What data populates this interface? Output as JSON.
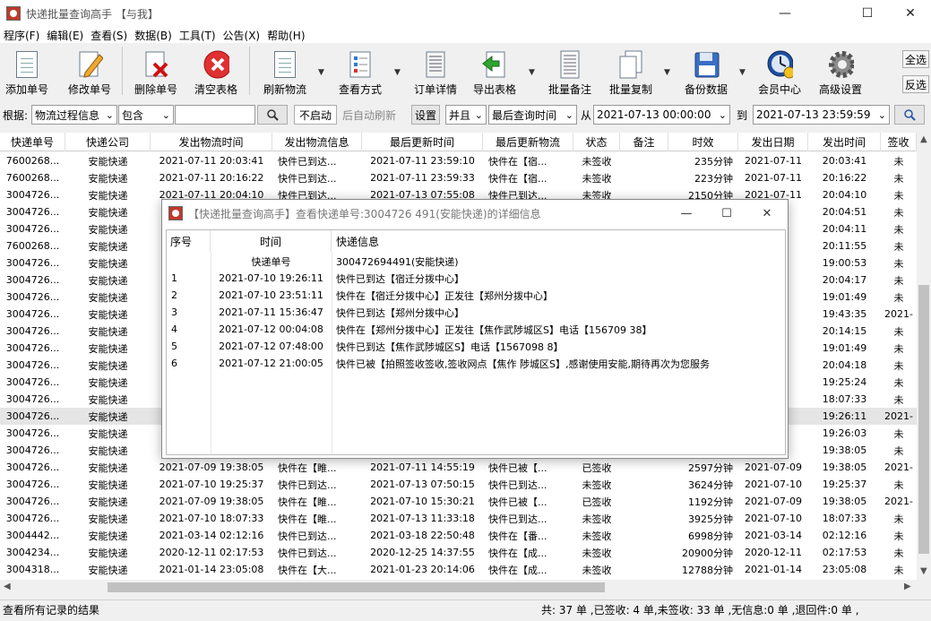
{
  "window": {
    "title": "快递批量查询高手 【与我】",
    "minimize": "—",
    "maximize": "☐",
    "close": "✕"
  },
  "menu": [
    "程序(F)",
    "编辑(E)",
    "查看(S)",
    "数据(B)",
    "工具(T)",
    "公告(X)",
    "帮助(H)"
  ],
  "toolbar": {
    "buttons": [
      {
        "label": "添加单号",
        "icon": "new-document-icon"
      },
      {
        "label": "修改单号",
        "icon": "edit-pencil-icon"
      },
      {
        "label": "删除单号",
        "icon": "delete-document-icon"
      },
      {
        "label": "清空表格",
        "icon": "clear-table-icon"
      },
      {
        "label": "刷新物流",
        "icon": "refresh-document-icon"
      },
      {
        "label": "查看方式",
        "icon": "view-mode-icon"
      },
      {
        "label": "订单详情",
        "icon": "order-detail-icon"
      },
      {
        "label": "导出表格",
        "icon": "export-table-icon"
      },
      {
        "label": "批量备注",
        "icon": "batch-note-icon"
      },
      {
        "label": "批量复制",
        "icon": "batch-copy-icon"
      },
      {
        "label": "备份数据",
        "icon": "backup-floppy-icon"
      },
      {
        "label": "会员中心",
        "icon": "member-center-icon"
      },
      {
        "label": "高级设置",
        "icon": "gear-icon"
      }
    ],
    "select_all": "全选",
    "invert": "反选"
  },
  "filter": {
    "by_label": "根据:",
    "field": "物流过程信息",
    "match": "包含",
    "keyword": "",
    "auto_refresh_state": "不启动",
    "auto_refresh_label": "后自动刷新",
    "settings": "设置",
    "logic": "并且",
    "date_field": "最后查询时间",
    "from_label": "从",
    "from_value": "2021-07-13 00:00:00",
    "to_label": "到",
    "to_value": "2021-07-13 23:59:59"
  },
  "table": {
    "columns": [
      "快递单号",
      "快递公司",
      "发出物流时间",
      "发出物流信息",
      "最后更新时间",
      "最后更新物流",
      "状态",
      "备注",
      "时效",
      "发出日期",
      "发出时间",
      "签收"
    ],
    "rows": [
      [
        "7600268...",
        "安能快递",
        "2021-07-11 20:03:41",
        "快件已到达...",
        "2021-07-11 23:59:10",
        "快件在【宿...",
        "未签收",
        "",
        "235分钟",
        "2021-07-11",
        "20:03:41",
        "未"
      ],
      [
        "7600268...",
        "安能快递",
        "2021-07-11 20:16:22",
        "快件已到达...",
        "2021-07-11 23:59:33",
        "快件在【宿...",
        "未签收",
        "",
        "223分钟",
        "2021-07-11",
        "20:16:22",
        "未"
      ],
      [
        "3004726...",
        "安能快递",
        "2021-07-11 20:04:10",
        "快件已到达...",
        "2021-07-13 07:55:08",
        "快件已到达...",
        "未签收",
        "",
        "2150分钟",
        "2021-07-11",
        "20:04:10",
        "未"
      ],
      [
        "3004726...",
        "安能快递",
        "",
        "",
        "",
        "",
        "",
        "",
        "",
        "10",
        "20:04:51",
        "未"
      ],
      [
        "3004726...",
        "安能快递",
        "",
        "",
        "",
        "",
        "",
        "",
        "",
        "11",
        "20:04:11",
        "未"
      ],
      [
        "7600268...",
        "安能快递",
        "",
        "",
        "",
        "",
        "",
        "",
        "",
        "11",
        "20:11:55",
        "未"
      ],
      [
        "3004726...",
        "安能快递",
        "",
        "",
        "",
        "",
        "",
        "",
        "",
        "09",
        "19:00:53",
        "未"
      ],
      [
        "3004726...",
        "安能快递",
        "",
        "",
        "",
        "",
        "",
        "",
        "",
        "10",
        "20:04:17",
        "未"
      ],
      [
        "3004726...",
        "安能快递",
        "",
        "",
        "",
        "",
        "",
        "",
        "",
        "09",
        "19:01:49",
        "未"
      ],
      [
        "3004726...",
        "安能快递",
        "",
        "",
        "",
        "",
        "",
        "",
        "",
        "09",
        "19:43:35",
        "2021-"
      ],
      [
        "3004726...",
        "安能快递",
        "",
        "",
        "",
        "",
        "",
        "",
        "",
        "10",
        "20:14:15",
        "未"
      ],
      [
        "3004726...",
        "安能快递",
        "",
        "",
        "",
        "",
        "",
        "",
        "",
        "09",
        "19:01:49",
        "未"
      ],
      [
        "3004726...",
        "安能快递",
        "",
        "",
        "",
        "",
        "",
        "",
        "",
        "10",
        "20:04:18",
        "未"
      ],
      [
        "3004726...",
        "安能快递",
        "",
        "",
        "",
        "",
        "",
        "",
        "",
        "10",
        "19:25:24",
        "未"
      ],
      [
        "3004726...",
        "安能快递",
        "",
        "",
        "",
        "",
        "",
        "",
        "",
        "10",
        "18:07:33",
        "未"
      ],
      [
        "3004726...",
        "安能快递",
        "",
        "",
        "",
        "",
        "",
        "",
        "",
        "10",
        "19:26:11",
        "2021-"
      ],
      [
        "3004726...",
        "安能快递",
        "",
        "",
        "",
        "",
        "",
        "",
        "",
        "10",
        "19:26:03",
        "未"
      ],
      [
        "3004726...",
        "安能快递",
        "",
        "",
        "",
        "",
        "",
        "",
        "",
        "09",
        "19:38:05",
        "未"
      ],
      [
        "3004726...",
        "安能快递",
        "2021-07-09 19:38:05",
        "快件在【睢...",
        "2021-07-11 14:55:19",
        "快件已被【...",
        "已签收",
        "",
        "2597分钟",
        "2021-07-09",
        "19:38:05",
        "2021-"
      ],
      [
        "3004726...",
        "安能快递",
        "2021-07-10 19:25:37",
        "快件已到达...",
        "2021-07-13 07:50:15",
        "快件已到达...",
        "未签收",
        "",
        "3624分钟",
        "2021-07-10",
        "19:25:37",
        "未"
      ],
      [
        "3004726...",
        "安能快递",
        "2021-07-09 19:38:05",
        "快件在【睢...",
        "2021-07-10 15:30:21",
        "快件已被【...",
        "已签收",
        "",
        "1192分钟",
        "2021-07-09",
        "19:38:05",
        "2021-"
      ],
      [
        "3004726...",
        "安能快递",
        "2021-07-10 18:07:33",
        "快件在【睢...",
        "2021-07-13 11:33:18",
        "快件已到达...",
        "未签收",
        "",
        "3925分钟",
        "2021-07-10",
        "18:07:33",
        "未"
      ],
      [
        "3004442...",
        "安能快递",
        "2021-03-14 02:12:16",
        "快件已到达...",
        "2021-03-18 22:50:48",
        "快件在【番...",
        "未签收",
        "",
        "6998分钟",
        "2021-03-14",
        "02:12:16",
        "未"
      ],
      [
        "3004234...",
        "安能快递",
        "2020-12-11 02:17:53",
        "快件已到达...",
        "2020-12-25 14:37:55",
        "快件在【成...",
        "未签收",
        "",
        "20900分钟",
        "2020-12-11",
        "02:17:53",
        "未"
      ],
      [
        "3004318...",
        "安能快递",
        "2021-01-14 23:05:08",
        "快件在【大...",
        "2021-01-23 20:14:06",
        "快件在【成...",
        "未签收",
        "",
        "12788分钟",
        "2021-01-14",
        "23:05:08",
        "未"
      ]
    ]
  },
  "status": {
    "left": "查看所有记录的结果",
    "right": "共: 37 单 ,已签收: 4 单,未签收: 33 单 ,无信息:0 单 ,退回件:0 单 ,"
  },
  "dialog": {
    "title": "【快递批量查询高手】查看快递单号:3004726  491(安能快递)的详细信息",
    "columns": [
      "序号",
      "时间",
      "快递信息"
    ],
    "tracking_label": "快递单号",
    "tracking_value": "300472694491(安能快递)",
    "rows": [
      [
        "1",
        "2021-07-10 19:26:11",
        "快件已到达【宿迁分拨中心】"
      ],
      [
        "2",
        "2021-07-10 23:51:11",
        "快件在【宿迁分拨中心】正发往【郑州分拨中心】"
      ],
      [
        "3",
        "2021-07-11 15:36:47",
        "快件已到达【郑州分拨中心】"
      ],
      [
        "4",
        "2021-07-12 00:04:08",
        "快件在【郑州分拨中心】正发往【焦作武陟城区S】电话【156709  38】"
      ],
      [
        "5",
        "2021-07-12 07:48:00",
        "快件已到达【焦作武陟城区S】电话【1567098  8】"
      ],
      [
        "6",
        "2021-07-12 21:00:05",
        "快件已被【拍照签收签收,签收网点【焦作  陟城区S】,感谢使用安能,期待再次为您服务"
      ]
    ]
  }
}
